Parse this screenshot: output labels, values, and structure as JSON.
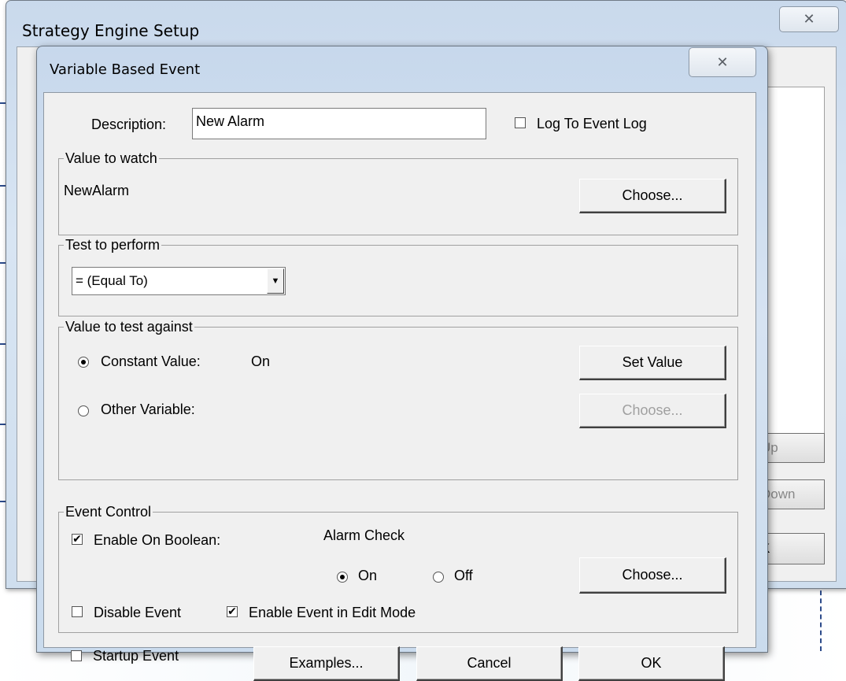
{
  "outer_window": {
    "title": "Strategy Engine Setup",
    "close_glyph": "✕",
    "side_buttons": {
      "up": "Up",
      "down": "Down",
      "ok_partial": "K"
    }
  },
  "dialog": {
    "title": "Variable Based Event",
    "close_glyph": "✕",
    "description_label": "Description:",
    "description_value": "New Alarm",
    "log_to_event_log": {
      "label": "Log To Event Log",
      "checked": false
    },
    "value_to_watch": {
      "legend": "Value to watch",
      "value": "NewAlarm",
      "choose_label": "Choose..."
    },
    "test_to_perform": {
      "legend": "Test to perform",
      "selected": "= (Equal To)"
    },
    "value_to_test_against": {
      "legend": "Value to test against",
      "constant_label": "Constant Value:",
      "constant_value": "On",
      "constant_selected": true,
      "set_value_label": "Set Value",
      "other_label": "Other Variable:",
      "other_selected": false,
      "choose_label": "Choose..."
    },
    "event_control": {
      "legend": "Event Control",
      "enable_on_boolean_label": "Enable On Boolean:",
      "enable_on_boolean_checked": true,
      "boolean_name": "Alarm Check",
      "on_label": "On",
      "on_selected": true,
      "off_label": "Off",
      "off_selected": false,
      "choose_label": "Choose...",
      "disable_event_label": "Disable Event",
      "disable_event_checked": false,
      "enable_in_edit_label": "Enable Event in Edit Mode",
      "enable_in_edit_checked": true
    },
    "startup_event": {
      "label": "Startup Event",
      "checked": false
    },
    "buttons": {
      "examples": "Examples...",
      "cancel": "Cancel",
      "ok": "OK"
    }
  }
}
